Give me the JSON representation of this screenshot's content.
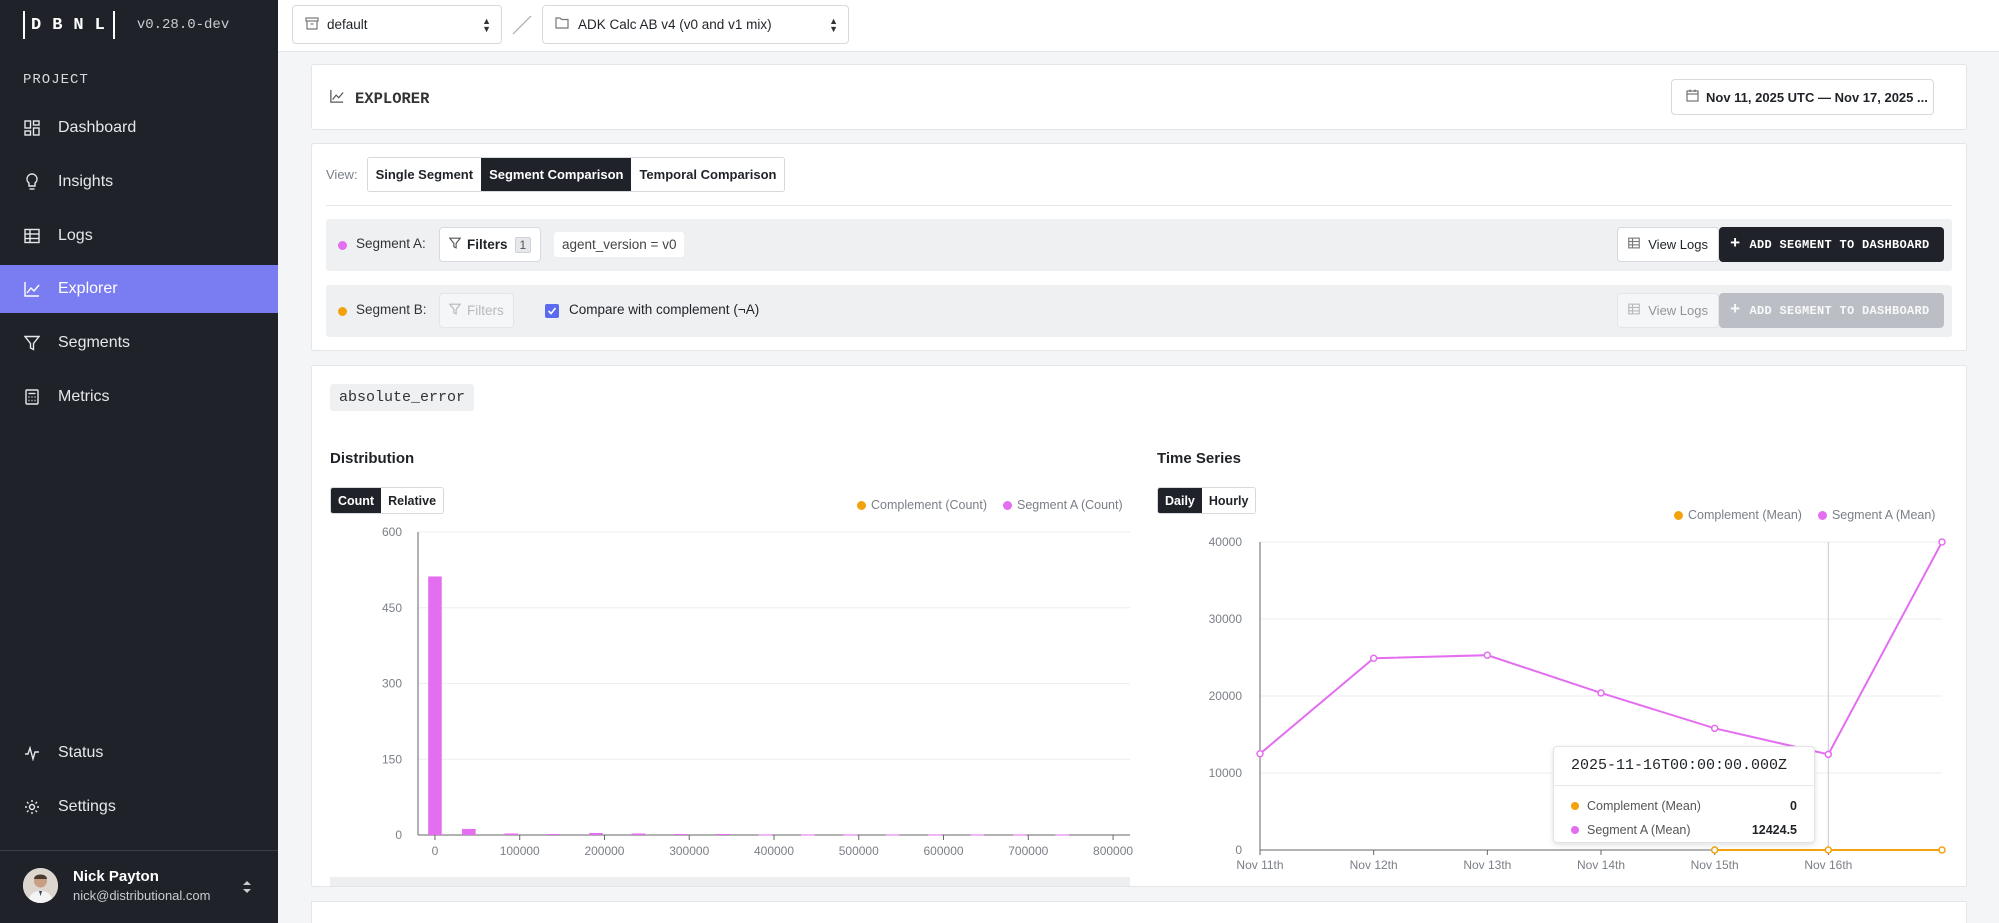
{
  "app": {
    "version": "v0.28.0-dev",
    "logo_letters": [
      "D",
      "B",
      "N",
      "L"
    ]
  },
  "sidebar": {
    "section": "PROJECT",
    "items": [
      {
        "label": "Dashboard",
        "icon": "dashboard-icon"
      },
      {
        "label": "Insights",
        "icon": "lightbulb-icon"
      },
      {
        "label": "Logs",
        "icon": "table-icon"
      },
      {
        "label": "Explorer",
        "icon": "chart-line-icon",
        "active": true
      },
      {
        "label": "Segments",
        "icon": "filter-icon"
      },
      {
        "label": "Metrics",
        "icon": "calculator-icon"
      }
    ],
    "bottom_items": [
      {
        "label": "Status",
        "icon": "pulse-icon"
      },
      {
        "label": "Settings",
        "icon": "gear-icon"
      }
    ],
    "user": {
      "name": "Nick Payton",
      "email": "nick@distributional.com"
    }
  },
  "topbar": {
    "namespace_select": "default",
    "project_select": "ADK Calc AB v4 (v0 and v1 mix)"
  },
  "explorer": {
    "title": "EXPLORER",
    "date_range": "Nov 11, 2025 UTC — Nov 17, 2025 ...",
    "view_label": "View:",
    "views": [
      {
        "label": "Single Segment",
        "active": false
      },
      {
        "label": "Segment Comparison",
        "active": true
      },
      {
        "label": "Temporal Comparison",
        "active": false
      }
    ],
    "segment_a": {
      "label": "Segment A:",
      "color": "#e46ef0",
      "filters_label": "Filters",
      "filters_count": "1",
      "filter_chip": "agent_version = v0",
      "view_logs": "View Logs",
      "add_button": "ADD SEGMENT TO DASHBOARD"
    },
    "segment_b": {
      "label": "Segment B:",
      "color": "#f2a20c",
      "filters_label": "Filters",
      "compare_label": "Compare with complement (¬A)",
      "compare_checked": true,
      "view_logs": "View Logs",
      "add_button": "ADD SEGMENT TO DASHBOARD"
    }
  },
  "metric": {
    "name": "absolute_error",
    "distribution": {
      "title": "Distribution",
      "toggle": [
        {
          "label": "Count",
          "active": true
        },
        {
          "label": "Relative",
          "active": false
        }
      ],
      "legend": [
        {
          "label": "Complement (Count)",
          "color": "#f2a20c"
        },
        {
          "label": "Segment A (Count)",
          "color": "#e46ef0"
        }
      ]
    },
    "timeseries": {
      "title": "Time Series",
      "toggle": [
        {
          "label": "Daily",
          "active": true
        },
        {
          "label": "Hourly",
          "active": false
        }
      ],
      "legend": [
        {
          "label": "Complement (Mean)",
          "color": "#f2a20c"
        },
        {
          "label": "Segment A (Mean)",
          "color": "#e46ef0"
        }
      ],
      "tooltip": {
        "title": "2025-11-16T00:00:00.000Z",
        "rows": [
          {
            "label": "Complement (Mean)",
            "value": "0",
            "color": "#f2a20c"
          },
          {
            "label": "Segment A (Mean)",
            "value": "12424.5",
            "color": "#e46ef0"
          }
        ]
      }
    }
  },
  "chart_data": [
    {
      "type": "bar",
      "title": "Distribution",
      "x_ticks": [
        "0",
        "100000",
        "200000",
        "300000",
        "400000",
        "500000",
        "600000",
        "700000",
        "800000"
      ],
      "y_ticks": [
        "0",
        "150",
        "300",
        "450",
        "600"
      ],
      "xlim": [
        -20000,
        820000
      ],
      "ylim": [
        0,
        600
      ],
      "series": [
        {
          "name": "Segment A (Count)",
          "color": "#e46ef0",
          "bins": [
            {
              "x": 0,
              "value": 512
            },
            {
              "x": 40000,
              "value": 12
            },
            {
              "x": 90000,
              "value": 3
            },
            {
              "x": 140000,
              "value": 2
            },
            {
              "x": 190000,
              "value": 4
            },
            {
              "x": 240000,
              "value": 3
            },
            {
              "x": 290000,
              "value": 2
            },
            {
              "x": 340000,
              "value": 2
            },
            {
              "x": 390000,
              "value": 1
            },
            {
              "x": 440000,
              "value": 1
            },
            {
              "x": 490000,
              "value": 1
            },
            {
              "x": 540000,
              "value": 1
            },
            {
              "x": 590000,
              "value": 1
            },
            {
              "x": 640000,
              "value": 1
            },
            {
              "x": 690000,
              "value": 1
            },
            {
              "x": 740000,
              "value": 1
            }
          ]
        },
        {
          "name": "Complement (Count)",
          "color": "#f2a20c",
          "bins": []
        }
      ]
    },
    {
      "type": "line",
      "title": "Time Series",
      "x": [
        "Nov 11th",
        "Nov 12th",
        "Nov 13th",
        "Nov 14th",
        "Nov 15th",
        "Nov 16th",
        "Nov 17th"
      ],
      "x_tick_labels": [
        "Nov 11th",
        "Nov 12th",
        "Nov 13th",
        "Nov 14th",
        "Nov 15th",
        "Nov 16th"
      ],
      "y_ticks": [
        "0",
        "10000",
        "20000",
        "30000",
        "40000"
      ],
      "ylim": [
        0,
        40000
      ],
      "series": [
        {
          "name": "Segment A (Mean)",
          "color": "#e46ef0",
          "values": [
            12500,
            24900,
            25300,
            20400,
            15800,
            12424.5,
            40000
          ]
        },
        {
          "name": "Complement (Mean)",
          "color": "#f2a20c",
          "values": [
            null,
            null,
            null,
            null,
            0,
            0,
            0
          ]
        }
      ]
    }
  ]
}
